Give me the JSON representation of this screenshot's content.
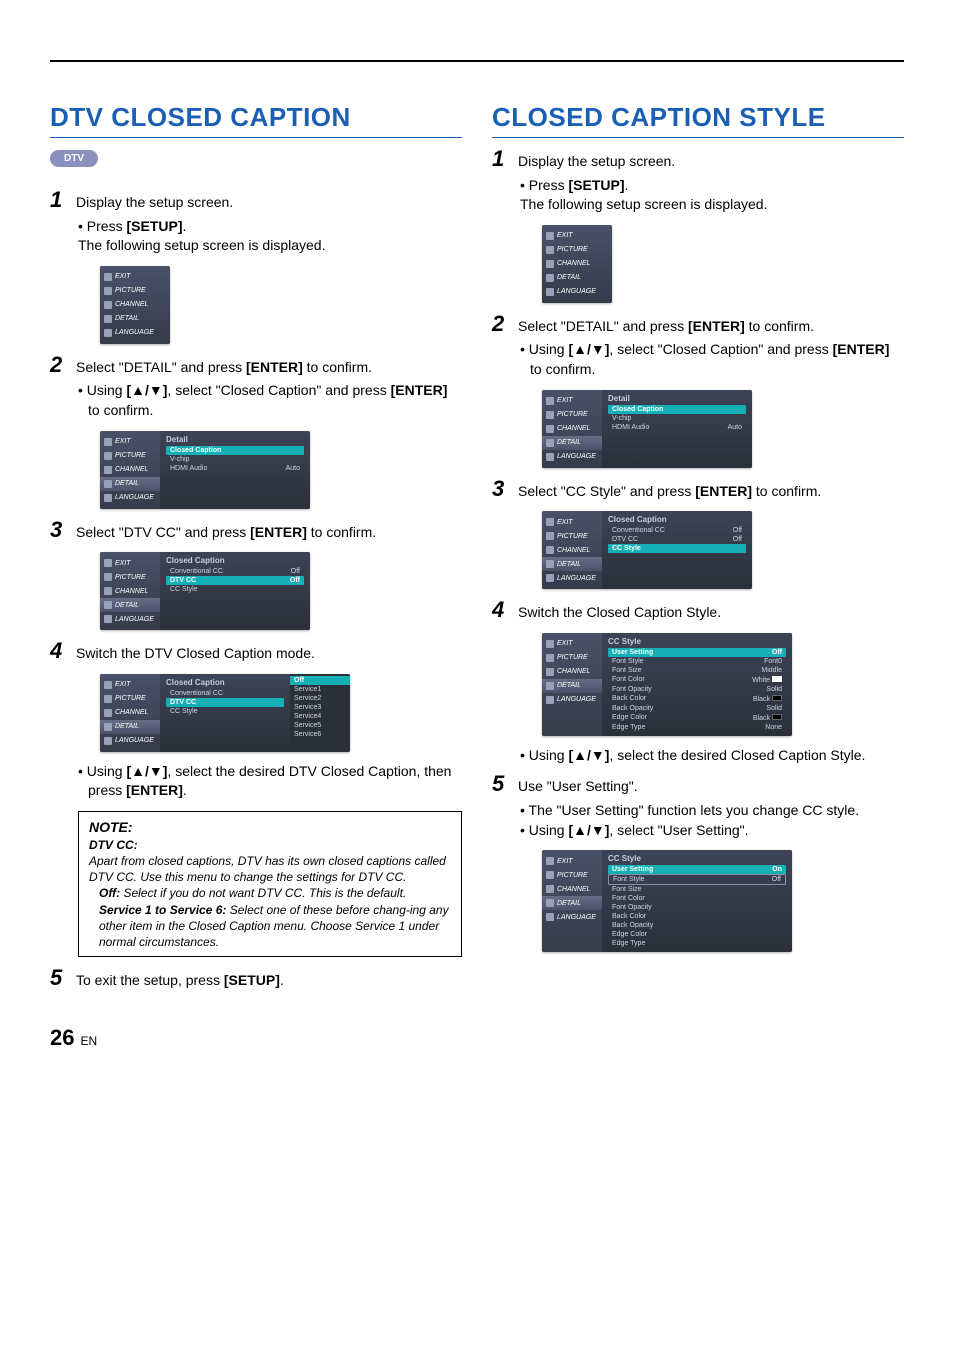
{
  "page": {
    "number": "26",
    "lang": "EN"
  },
  "left": {
    "title": "DTV CLOSED CAPTION",
    "pill": "DTV",
    "step1": "Display the setup screen.",
    "step1_b1a": "Press ",
    "step1_b1b": "[SETUP]",
    "step1_b1c": ".",
    "step1_line2": "The following setup screen is displayed.",
    "step2a": "Select \"DETAIL\" and press ",
    "step2b": "[ENTER]",
    "step2c": " to confirm.",
    "step2_b1a": "Using ",
    "step2_b1b": "[▲/▼]",
    "step2_b1c": ", select \"Closed Caption\" and press ",
    "step2_b1d": "[ENTER]",
    "step2_b1e": " to confirm.",
    "step3a": "Select \"DTV CC\" and press ",
    "step3b": "[ENTER]",
    "step3c": " to confirm.",
    "step4": "Switch the DTV Closed Caption mode.",
    "step4_b1a": "Using ",
    "step4_b1b": "[▲/▼]",
    "step4_b1c": ", select the desired DTV Closed Caption, then press ",
    "step4_b1d": "[ENTER]",
    "step4_b1e": ".",
    "note": {
      "title": "NOTE:",
      "sub": "DTV CC:",
      "body1": "Apart from closed captions, DTV has its own closed captions called DTV CC. Use this menu to change the settings for DTV CC.",
      "off_lbl": "Off:",
      "off_txt": " Select if you do not want DTV CC. This is the default.",
      "svc_lbl": "Service 1 to Service 6:",
      "svc_txt": " Select one of these before chang-ing any other item in the Closed Caption menu. Choose Service 1 under normal circumstances."
    },
    "step5a": "To exit the setup, press ",
    "step5b": "[SETUP]",
    "step5c": "."
  },
  "right": {
    "title": "CLOSED CAPTION STYLE",
    "step1": "Display the setup screen.",
    "step1_b1a": "Press ",
    "step1_b1b": "[SETUP]",
    "step1_b1c": ".",
    "step1_line2": "The following setup screen is displayed.",
    "step2a": "Select \"DETAIL\" and press ",
    "step2b": "[ENTER]",
    "step2c": " to confirm.",
    "step2_b1a": "Using ",
    "step2_b1b": "[▲/▼]",
    "step2_b1c": ", select \"Closed Caption\" and press ",
    "step2_b1d": "[ENTER]",
    "step2_b1e": " to confirm.",
    "step3a": "Select \"CC Style\" and press  ",
    "step3b": "[ENTER]",
    "step3c": " to confirm.",
    "step4": "Switch the Closed Caption Style.",
    "step4_b1a": "Using ",
    "step4_b1b": "[▲/▼]",
    "step4_b1c": ", select the desired Closed Caption Style.",
    "step5": "Use \"User Setting\".",
    "step5_b1": "The \"User Setting\" function lets you change CC style.",
    "step5_b2a": "Using ",
    "step5_b2b": "[▲/▼]",
    "step5_b2c": ", select \"User Setting\"."
  },
  "osd": {
    "sidebar": [
      "EXIT",
      "PICTURE",
      "CHANNEL",
      "DETAIL",
      "LANGUAGE"
    ],
    "detail_title": "Detail",
    "detail_rows": [
      {
        "l": "Closed Caption",
        "v": "",
        "hl": true
      },
      {
        "l": "V-chip",
        "v": ""
      },
      {
        "l": "HDMI Audio",
        "v": "Auto"
      }
    ],
    "cc_title": "Closed Caption",
    "cc_rows_dtv": [
      {
        "l": "Conventional CC",
        "v": "Off"
      },
      {
        "l": "DTV CC",
        "v": "Off",
        "hl": true
      },
      {
        "l": "CC Style",
        "v": ""
      }
    ],
    "cc_rows_style": [
      {
        "l": "Conventional CC",
        "v": "Off"
      },
      {
        "l": "DTV CC",
        "v": "Off"
      },
      {
        "l": "CC Style",
        "v": "",
        "hl": true
      }
    ],
    "dtv_drop_rows": [
      {
        "l": "Conventional CC",
        "v": ""
      },
      {
        "l": "DTV CC",
        "v": ""
      },
      {
        "l": "CC Style",
        "v": ""
      }
    ],
    "dtv_drop": [
      "Off",
      "Service1",
      "Service2",
      "Service3",
      "Service4",
      "Service5",
      "Service6"
    ],
    "ccstyle_title": "CC Style",
    "ccstyle_rows_off": [
      {
        "l": "User Setting",
        "v": "Off",
        "hl": true
      },
      {
        "l": "Font Style",
        "v": "Font0"
      },
      {
        "l": "Font Size",
        "v": "Middle"
      },
      {
        "l": "Font Color",
        "v": "White",
        "swatch": "#ffffff"
      },
      {
        "l": "Font Opacity",
        "v": "Solid"
      },
      {
        "l": "Back Color",
        "v": "Black",
        "swatch": "#000000"
      },
      {
        "l": "Back Opacity",
        "v": "Solid"
      },
      {
        "l": "Edge Color",
        "v": "Black",
        "swatch": "#000000"
      },
      {
        "l": "Edge Type",
        "v": "None"
      }
    ],
    "ccstyle_rows_on": [
      {
        "l": "User Setting",
        "v": "On",
        "hl": true
      },
      {
        "l": "Font Style",
        "v": "Off",
        "box": true
      },
      {
        "l": "Font Size",
        "v": ""
      },
      {
        "l": "Font Color",
        "v": ""
      },
      {
        "l": "Font Opacity",
        "v": ""
      },
      {
        "l": "Back Color",
        "v": ""
      },
      {
        "l": "Back Opacity",
        "v": ""
      },
      {
        "l": "Edge Color",
        "v": ""
      },
      {
        "l": "Edge Type",
        "v": ""
      }
    ]
  }
}
